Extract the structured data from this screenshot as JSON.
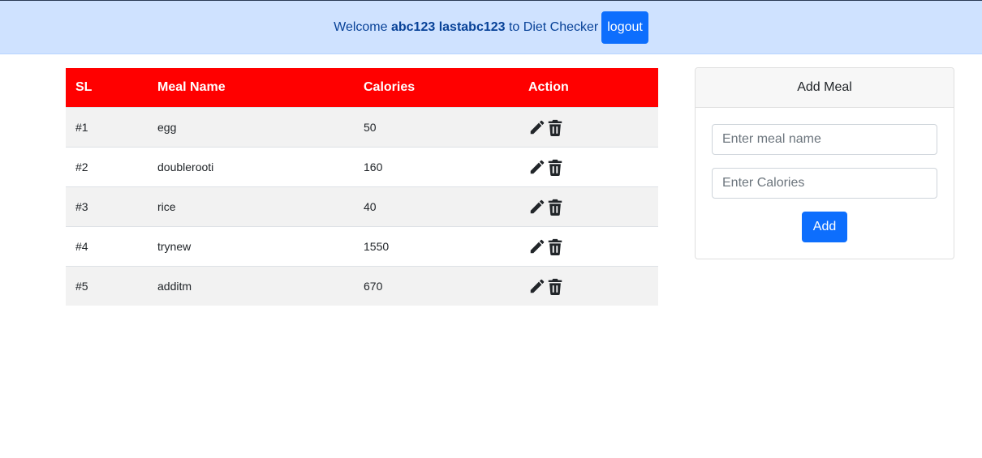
{
  "header": {
    "welcome_prefix": "Welcome",
    "user_name": "abc123 lastabc123",
    "welcome_suffix": "to Diet Checker",
    "logout_label": "logout"
  },
  "table": {
    "headers": [
      "SL",
      "Meal Name",
      "Calories",
      "Action"
    ],
    "rows": [
      {
        "sl": "#1",
        "name": "egg",
        "calories": "50"
      },
      {
        "sl": "#2",
        "name": "doublerooti",
        "calories": "160"
      },
      {
        "sl": "#3",
        "name": "rice",
        "calories": "40"
      },
      {
        "sl": "#4",
        "name": "trynew",
        "calories": "1550"
      },
      {
        "sl": "#5",
        "name": "additm",
        "calories": "670"
      }
    ],
    "action_icons": [
      "pencil-icon",
      "trash-icon"
    ]
  },
  "form": {
    "title": "Add Meal",
    "meal_placeholder": "Enter meal name",
    "meal_value": "",
    "calories_placeholder": "Enter Calories",
    "calories_value": "",
    "add_label": "Add"
  },
  "colors": {
    "header_bg": "#cfe2ff",
    "table_header_bg": "#ff0000",
    "primary_button": "#0d6efd"
  }
}
